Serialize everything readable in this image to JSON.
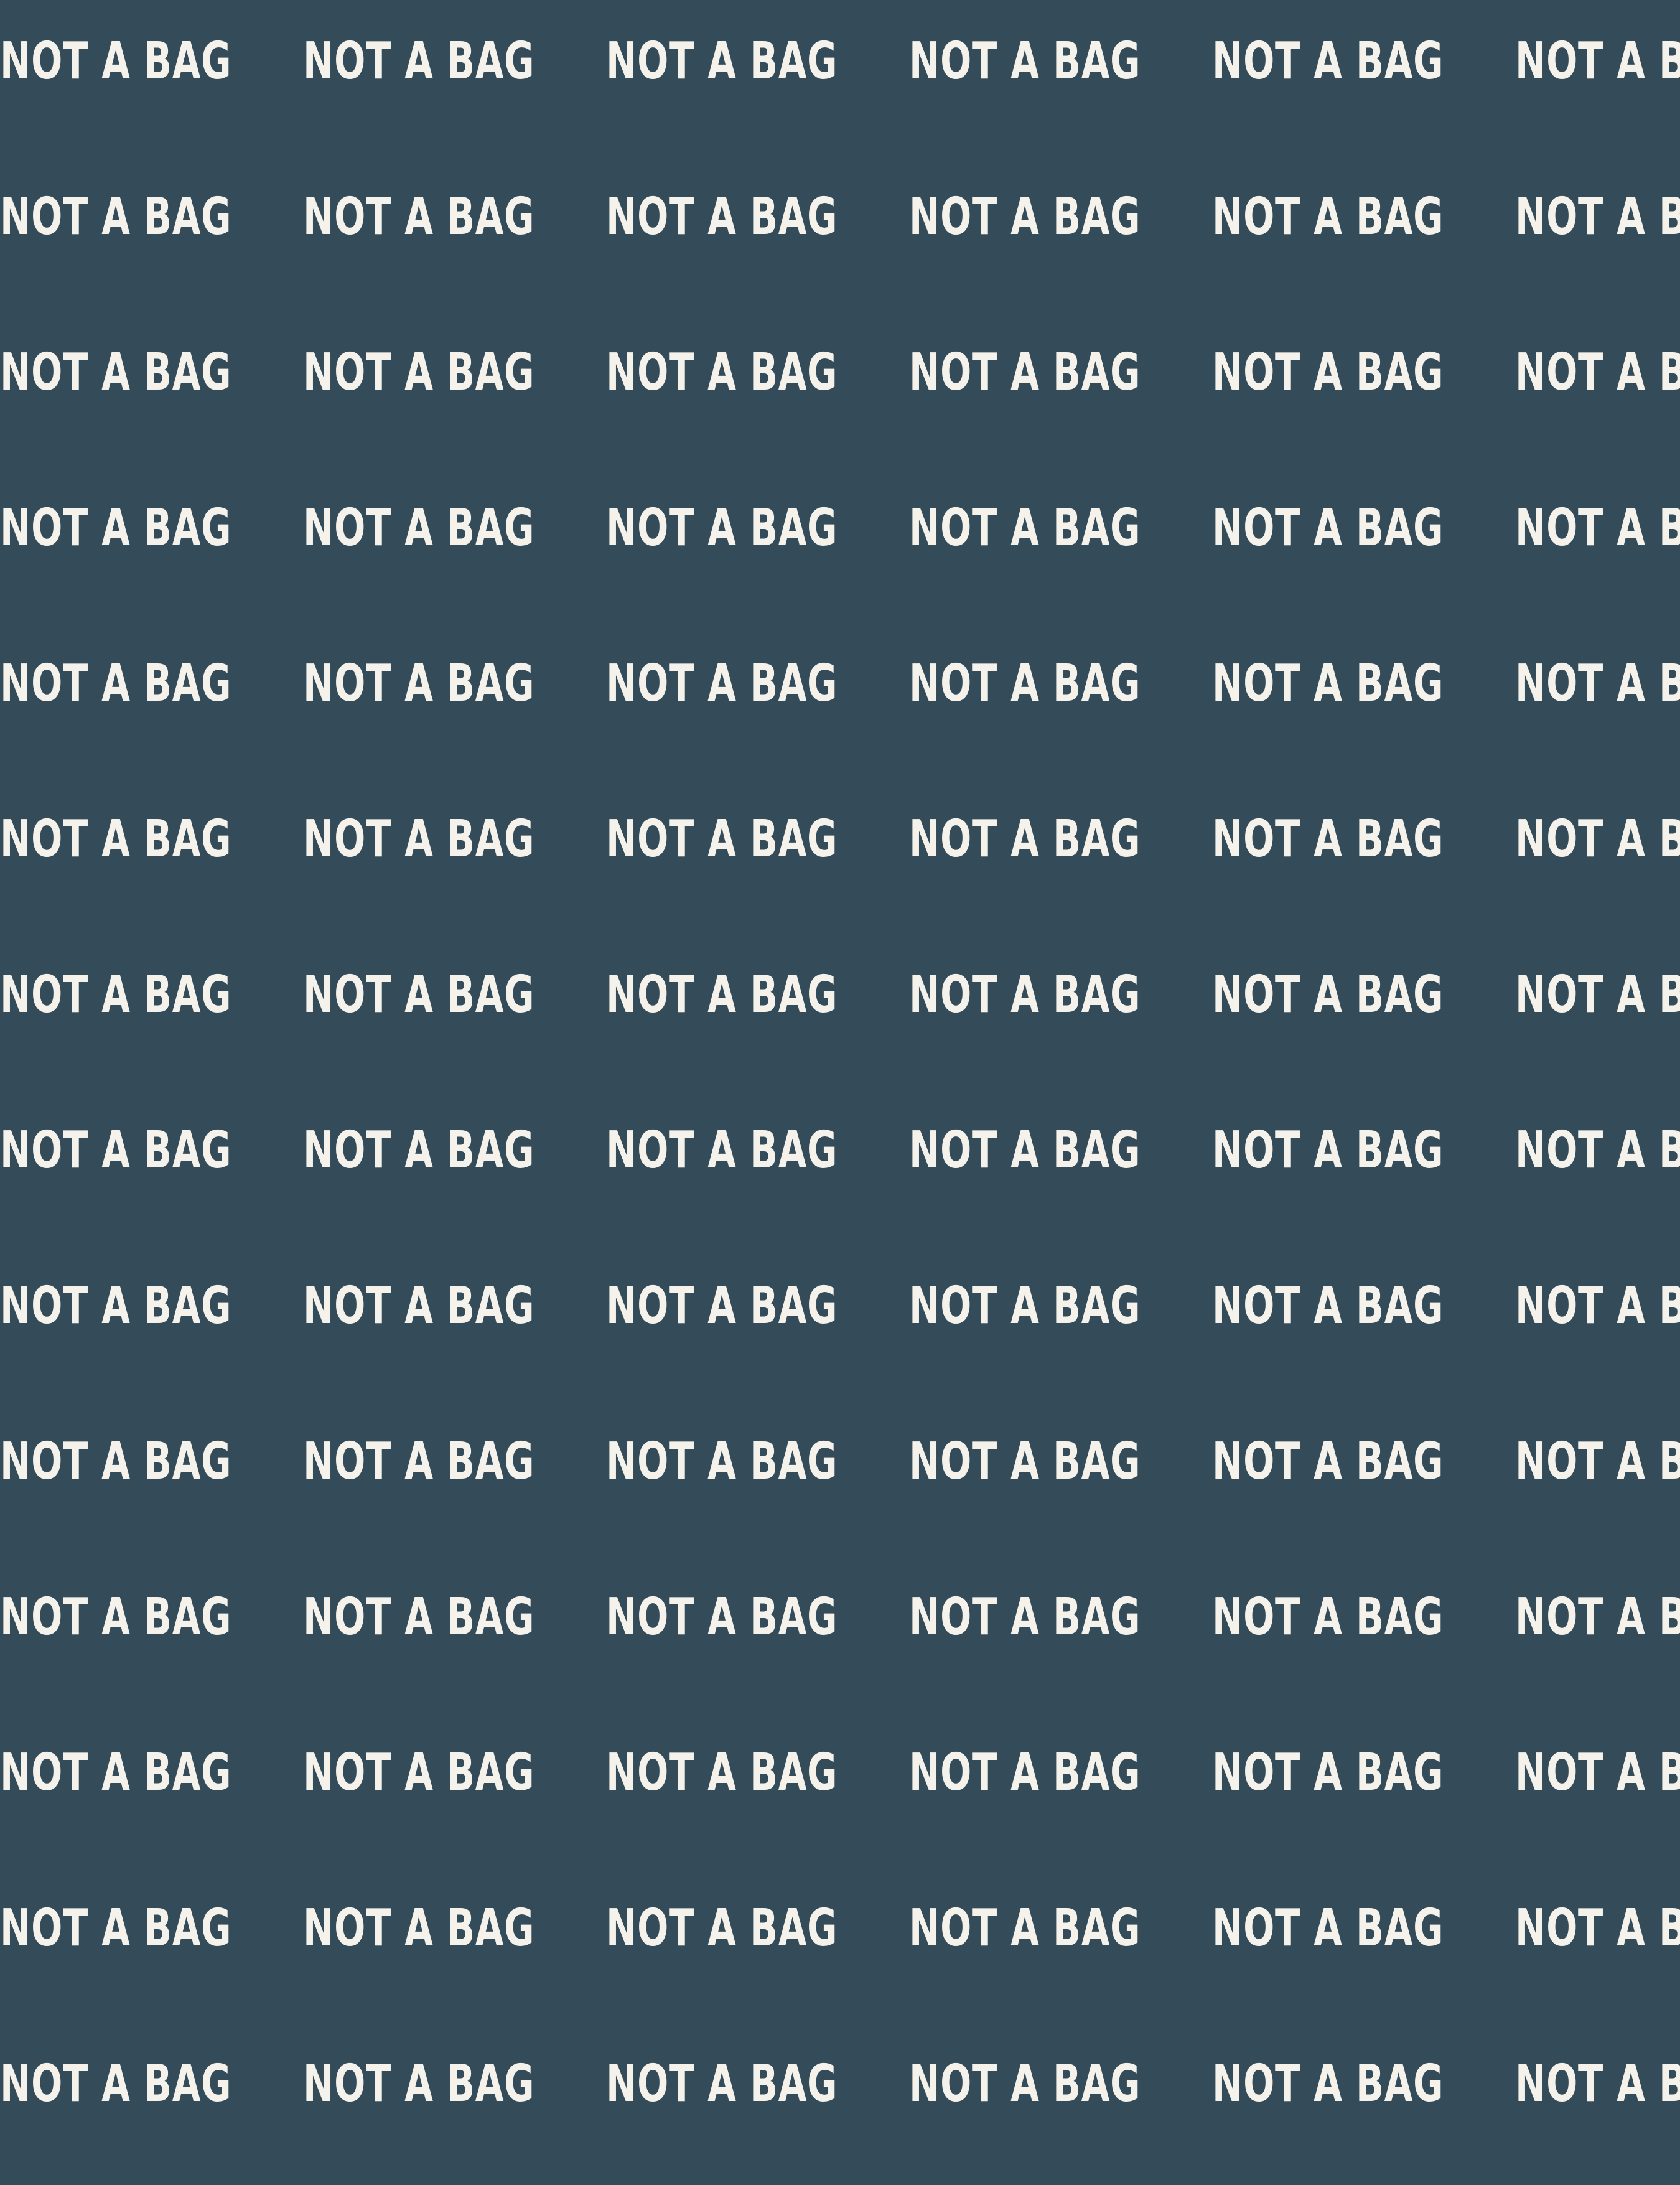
{
  "pattern": {
    "text": "NOT A BAG",
    "rows": 14,
    "columns": 6,
    "background_color": "#344B5A",
    "text_color": "#F4F2EA"
  }
}
